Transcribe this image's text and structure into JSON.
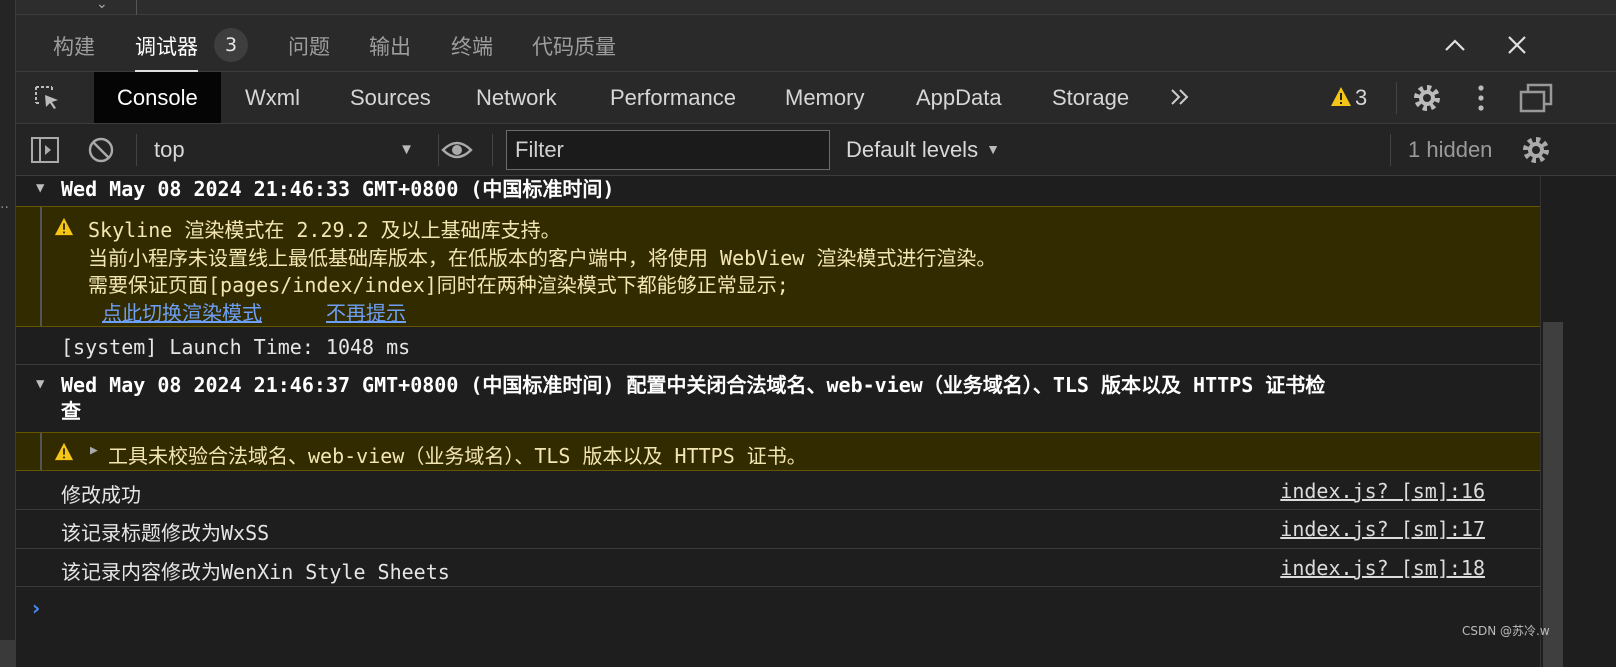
{
  "panel_tabs": [
    {
      "label": "构建"
    },
    {
      "label": "调试器",
      "badge": "3",
      "active": true
    },
    {
      "label": "问题"
    },
    {
      "label": "输出"
    },
    {
      "label": "终端"
    },
    {
      "label": "代码质量"
    }
  ],
  "devtools_tabs": [
    "Console",
    "Wxml",
    "Sources",
    "Network",
    "Performance",
    "Memory",
    "AppData",
    "Storage"
  ],
  "devtools_active_tab": "Console",
  "warning_count": "3",
  "toolbar": {
    "context": "top",
    "filter_placeholder": "Filter",
    "levels": "Default levels",
    "hidden_count": "1 hidden"
  },
  "console": {
    "group1": "Wed May 08 2024 21:46:33 GMT+0800 (中国标准时间)",
    "warn1": {
      "line1": "Skyline 渲染模式在 2.29.2 及以上基础库支持。",
      "line2": "当前小程序未设置线上最低基础库版本，在低版本的客户端中，将使用 WebView 渲染模式进行渲染。",
      "line3": "需要保证页面[pages/index/index]同时在两种渲染模式下都能够正常显示;",
      "link1": "点此切换渲染模式",
      "link2": "不再提示"
    },
    "launch": "[system] Launch Time: 1048 ms",
    "group2_line1": "Wed May 08 2024 21:46:37 GMT+0800 (中国标准时间) 配置中关闭合法域名、web-view（业务域名）、TLS 版本以及 HTTPS 证书检",
    "group2_line2": "查",
    "warn2": "工具未校验合法域名、web-view（业务域名）、TLS 版本以及 HTTPS 证书。",
    "logs": [
      {
        "text": "修改成功",
        "source": "index.js? [sm]:16"
      },
      {
        "text": "该记录标题修改为WxSS",
        "source": "index.js? [sm]:17"
      },
      {
        "text": "该记录内容修改为WenXin Style Sheets",
        "source": "index.js? [sm]:18"
      }
    ]
  },
  "watermark": "CSDN @苏冷.w",
  "colors": {
    "warning_bg": "#332b00",
    "warning_icon": "#f5c518",
    "link": "#6c9ff5",
    "prompt": "#4a8bf5"
  }
}
